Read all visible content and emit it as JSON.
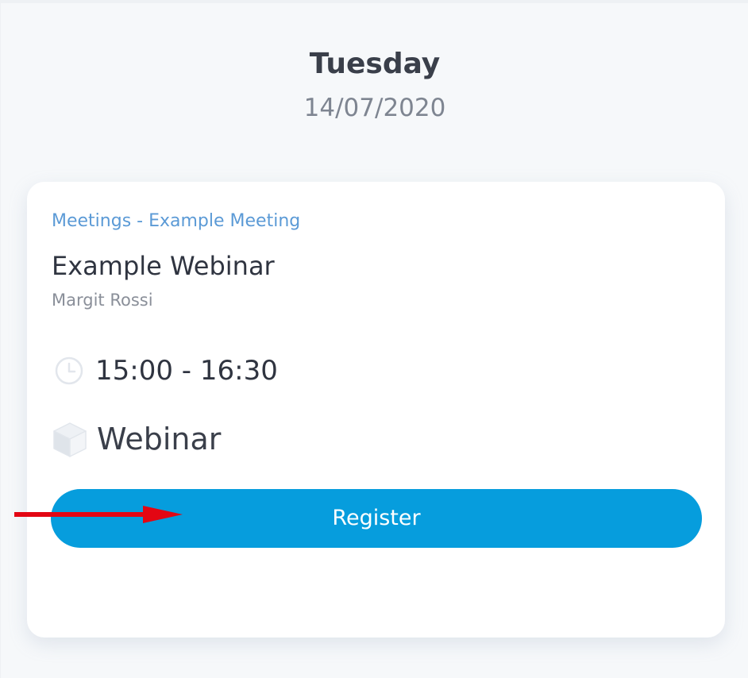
{
  "day": {
    "name": "Tuesday",
    "date": "14/07/2020"
  },
  "event": {
    "category": "Meetings - Example Meeting",
    "title": "Example Webinar",
    "speaker": "Margit Rossi",
    "time": "15:00 - 16:30",
    "type": "Webinar",
    "register_label": "Register",
    "time_icon": "clock-icon",
    "type_icon": "cube-icon"
  },
  "annotation": {
    "icon": "arrow-right-icon",
    "color": "#e30613"
  },
  "colors": {
    "accent": "#069ddd",
    "category_text": "#5b9ad6",
    "background": "#f6f8fa"
  }
}
